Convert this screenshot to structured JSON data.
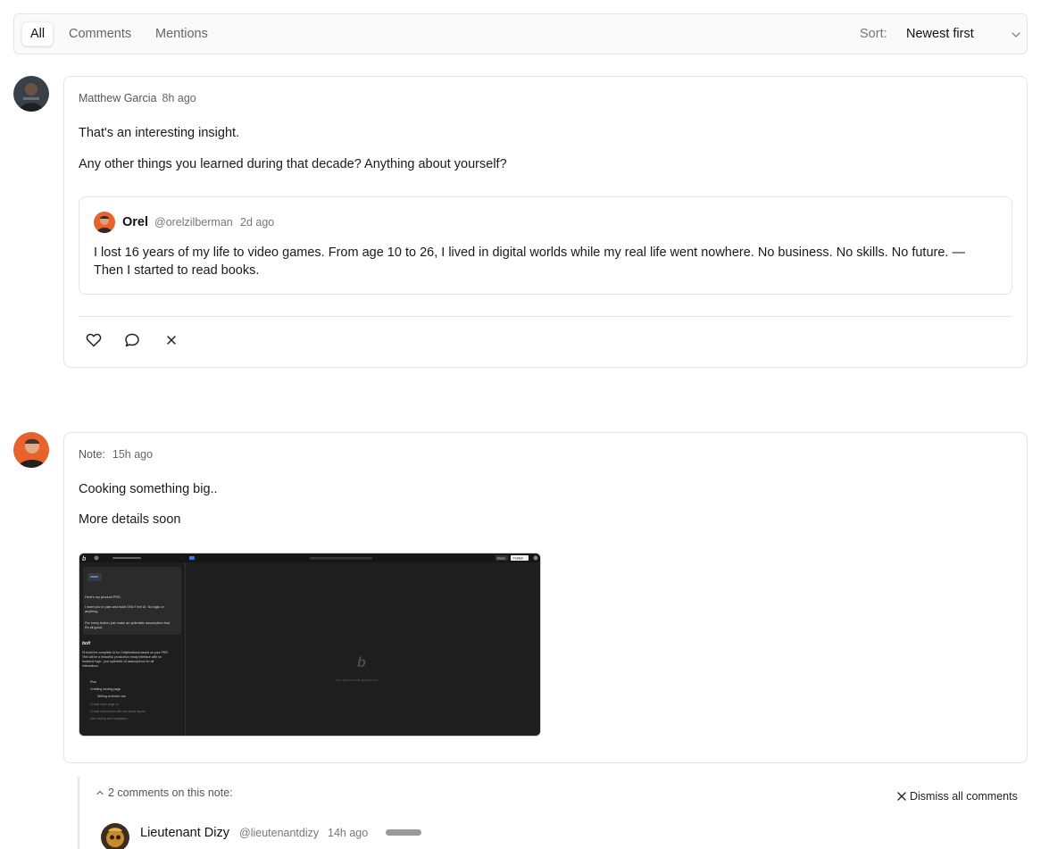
{
  "tabs": [
    {
      "label": "All",
      "active": true
    },
    {
      "label": "Comments",
      "active": false
    },
    {
      "label": "Mentions",
      "active": false
    }
  ],
  "sort": {
    "label": "Sort:",
    "value": "Newest first",
    "icon": "chevron-down-icon"
  },
  "posts": [
    {
      "author": "Matthew Garcia",
      "time": "8h ago",
      "paragraphs": [
        "That's an interesting insight.",
        "Any other things you learned during that decade? Anything about yourself?"
      ],
      "quote": {
        "name": "Orel",
        "handle": "@orelzilberman",
        "time": "2d ago",
        "text": "I lost 16 years of my life to video games. From age 10 to 26, I lived in digital worlds while my real life went nowhere. No business. No skills. No future. — Then I started to read books."
      },
      "actions": [
        "heart-icon",
        "comment-icon",
        "close-icon"
      ]
    },
    {
      "author": "Note:",
      "time": "15h ago",
      "paragraphs": [
        "Cooking something big..",
        "More details soon"
      ],
      "image": {
        "prompt_text": "Here's my product PRD.",
        "prompt_text2": "I want you to plan and build ONLY the UI. No logic or anything.",
        "prompt_text3": "For every button just make an optimistic assumption that it's all good.",
        "agent_name": "bolt",
        "agent_text": "I'll build the complete UI for Onlyfeedback based on your PRD. This will be a beautiful, production ready interface with no backend logic - just optimistic UI assumptions for all interactions.",
        "steps": [
          "Plan",
          "Creating landing page",
          "Writing src/index.css",
          "Create login page ui",
          "Create dashboard with two panel layout",
          "Add routing and navigation"
        ],
        "preview_text": "Your preview will appear here",
        "share_label": "Share",
        "publish_label": "Publish"
      }
    }
  ],
  "thread": {
    "toggle_label": "2 comments on this note:",
    "dismiss_label": "Dismiss all comments",
    "first_comment": {
      "name": "Lieutenant Dizy",
      "handle": "@lieutenantdizy",
      "time": "14h ago"
    }
  },
  "colors": {
    "accent": "#e8622c",
    "border": "#e5e5e5",
    "muted": "#777777"
  }
}
